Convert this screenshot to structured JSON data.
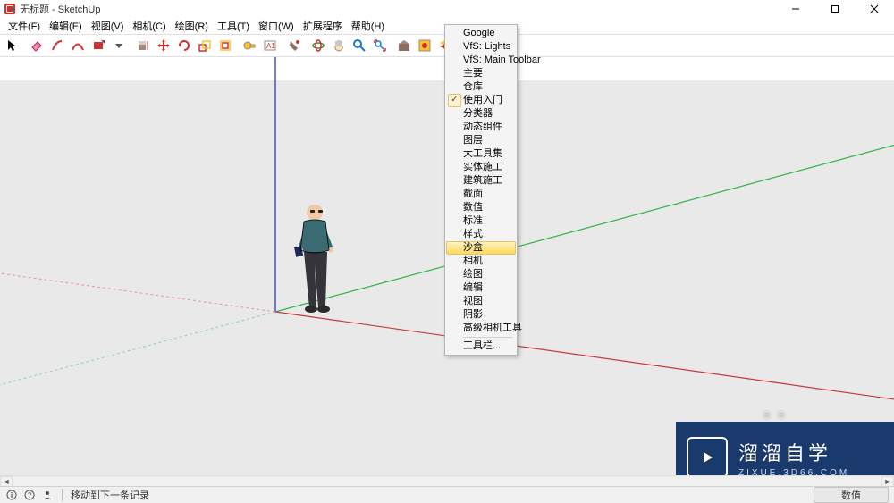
{
  "window": {
    "title": "无标题 - SketchUp"
  },
  "menu": {
    "items": [
      "文件(F)",
      "编辑(E)",
      "视图(V)",
      "相机(C)",
      "绘图(R)",
      "工具(T)",
      "窗口(W)",
      "扩展程序",
      "帮助(H)"
    ]
  },
  "toolbar": {
    "icons": [
      "select-arrow",
      "eraser",
      "line",
      "arc",
      "rectangle",
      "pushpull",
      "move",
      "rotate",
      "scale",
      "offset",
      "tape",
      "protractor",
      "orbit",
      "pan",
      "zoom",
      "zoom-extents",
      "paint",
      "3dwarehouse",
      "layers",
      "outliner",
      "sandbox"
    ]
  },
  "context_menu": {
    "checked_index": 5,
    "highlighted_index": 15,
    "items": [
      "Google",
      "VfS: Lights",
      "VfS: Main Toolbar",
      "主要",
      "仓库",
      "使用入门",
      "分类器",
      "动态组件",
      "图层",
      "大工具集",
      "实体施工",
      "建筑施工",
      "截面",
      "数值",
      "标准",
      "样式",
      "沙盒",
      "相机",
      "绘图",
      "编辑",
      "视图",
      "阴影",
      "高级相机工具"
    ],
    "footer_item": "工具栏..."
  },
  "status": {
    "hint": "移动到下一条记录",
    "measure_label": "数值"
  },
  "watermark": {
    "line1": "溜溜自学",
    "line2": "ZIXUE.3D66.COM"
  }
}
